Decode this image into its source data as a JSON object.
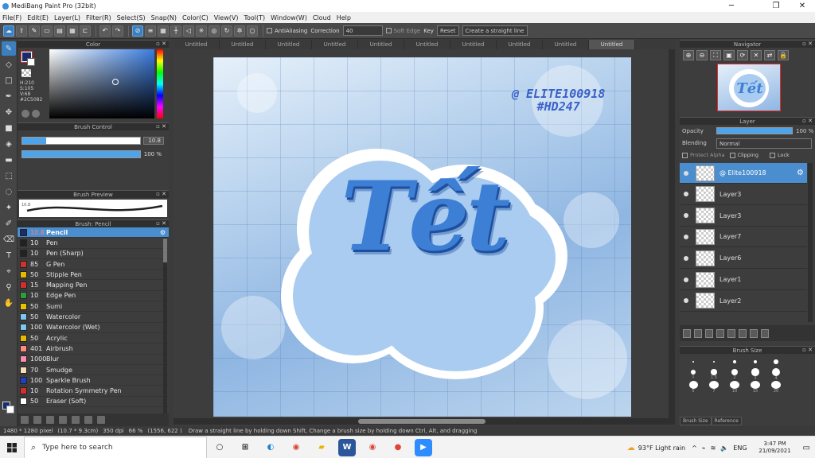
{
  "window": {
    "title": "MediBang Paint Pro (32bit)",
    "controls": {
      "minimize": "─",
      "maximize": "❐",
      "close": "✕"
    }
  },
  "menu": [
    "File(F)",
    "Edit(E)",
    "Layer(L)",
    "Filter(R)",
    "Select(S)",
    "Snap(N)",
    "Color(C)",
    "View(V)",
    "Tool(T)",
    "Window(W)",
    "Cloud",
    "Help"
  ],
  "toolbar": {
    "antialiasing": "AntiAliasing",
    "correction_label": "Correction",
    "correction_value": "40",
    "soft_edge": "Soft Edge",
    "key": "Key",
    "reset": "Reset",
    "straight_line": "Create a straight line"
  },
  "color_panel": {
    "title": "Color",
    "h": "H:210",
    "s": "S:105",
    "v": "V:68",
    "hex": "#2C5082",
    "fg_color": "#1a2a6a"
  },
  "brush_control": {
    "title": "Brush Control",
    "size_value": "10.8",
    "size_fraction": 0.2,
    "opacity_value": "100 %",
    "opacity_fraction": 1.0
  },
  "brush_preview": {
    "title": "Brush Preview",
    "size": "10.8"
  },
  "brush_list": {
    "title": "Brush: Pencil",
    "items": [
      {
        "size": "10.8",
        "name": "Pencil",
        "color": "#1a2a6a",
        "selected": true
      },
      {
        "size": "10",
        "name": "Pen",
        "color": "#222222"
      },
      {
        "size": "10",
        "name": "Pen (Sharp)",
        "color": "#222222"
      },
      {
        "size": "85",
        "name": "G Pen",
        "color": "#d32f2f"
      },
      {
        "size": "50",
        "name": "Stipple Pen",
        "color": "#e6b800"
      },
      {
        "size": "15",
        "name": "Mapping Pen",
        "color": "#d32f2f"
      },
      {
        "size": "10",
        "name": "Edge Pen",
        "color": "#2e9e3a"
      },
      {
        "size": "50",
        "name": "Sumi",
        "color": "#e6c200"
      },
      {
        "size": "50",
        "name": "Watercolor",
        "color": "#7fc6ef"
      },
      {
        "size": "100",
        "name": "Watercolor (Wet)",
        "color": "#7fc6ef"
      },
      {
        "size": "50",
        "name": "Acrylic",
        "color": "#e6b800"
      },
      {
        "size": "401",
        "name": "Airbrush",
        "color": "#ff8a80"
      },
      {
        "size": "1000",
        "name": "Blur",
        "color": "#f48fb1"
      },
      {
        "size": "70",
        "name": "Smudge",
        "color": "#f5deb3"
      },
      {
        "size": "100",
        "name": "Sparkle Brush",
        "color": "#1e3fbf"
      },
      {
        "size": "10",
        "name": "Rotation Symmetry Pen",
        "color": "#d32f2f"
      },
      {
        "size": "50",
        "name": "Eraser (Soft)",
        "color": "#ffffff"
      }
    ]
  },
  "tabs": [
    "Untitled",
    "Untitled",
    "Untitled",
    "Untitled",
    "Untitled",
    "Untitled",
    "Untitled",
    "Untitled",
    "Untitled",
    "Untitled"
  ],
  "artwork": {
    "handle": "@ ELITE100918",
    "tag": "#HD247",
    "word": "Tết"
  },
  "navigator": {
    "title": "Navigator",
    "thumb_text": "Tết"
  },
  "layer_panel": {
    "title": "Layer",
    "opacity_label": "Opacity",
    "opacity_value": "100 %",
    "opacity_fraction": 1.0,
    "blending_label": "Blending",
    "blending_value": "Normal",
    "protect_alpha": "Protect Alpha",
    "clipping": "Clipping",
    "lock": "Lock",
    "layers": [
      {
        "name": "@ Elite100918",
        "selected": true
      },
      {
        "name": "Layer3"
      },
      {
        "name": "Layer3"
      },
      {
        "name": "Layer7"
      },
      {
        "name": "Layer6"
      },
      {
        "name": "Layer1"
      },
      {
        "name": "Layer2"
      }
    ]
  },
  "brush_size_panel": {
    "title": "Brush Size",
    "tab_size": "Brush Size",
    "tab_ref": "Reference",
    "sizes": [
      "",
      "",
      "",
      "",
      "",
      "1",
      "1.5",
      "2",
      "3",
      "4",
      "5",
      "7",
      "10",
      "15",
      "20"
    ]
  },
  "statusbar": {
    "dims": "1480 * 1280 pixel",
    "size_cm": "(10.7 * 9.3cm)",
    "dpi": "350 dpi",
    "zoom": "66 %",
    "coords": "(1556, 622 )",
    "hint": "Draw a straight line by holding down Shift, Change a brush size by holding down Ctrl, Alt, and dragging"
  },
  "taskbar": {
    "search_placeholder": "Type here to search",
    "weather": "93°F  Light rain",
    "lang": "ENG",
    "time": "3:47 PM",
    "date": "21/09/2021"
  }
}
